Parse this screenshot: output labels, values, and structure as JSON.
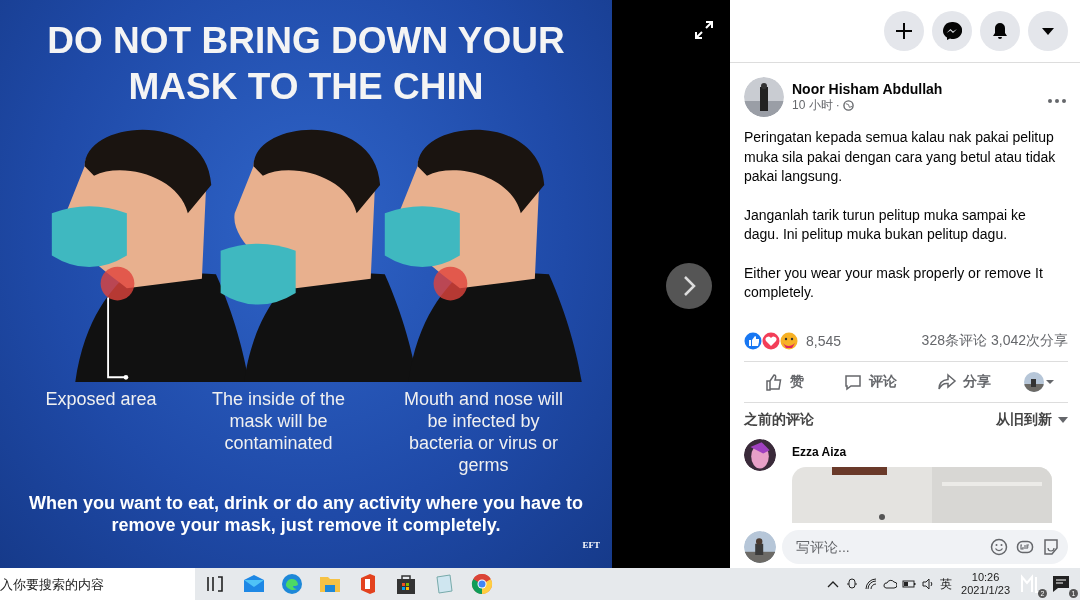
{
  "viewer": {
    "poster": {
      "headline": "DO NOT BRING DOWN YOUR MASK TO THE CHIN",
      "captions": [
        "Exposed area",
        "The inside of the mask will be contaminated",
        "Mouth and nose will be infected by bacteria or virus or germs"
      ],
      "footer": "When you want to eat, drink or do any activity where you have to remove your mask, just remove it completely.",
      "credit": "EFT"
    }
  },
  "post": {
    "author": "Noor Hisham Abdullah",
    "time": "10 小时",
    "separator": "·",
    "paragraphs": [
      "Peringatan kepada semua kalau nak pakai pelitup muka sila pakai dengan cara yang betul atau tidak pakai langsung.",
      "Janganlah tarik turun pelitup muka sampai ke dagu. Ini pelitup muka bukan pelitup dagu.",
      "Either you wear your mask properly or remove It completely."
    ],
    "reaction_count": "8,545",
    "comment_count": "328条评论",
    "share_count": "3,042次分享",
    "actions": [
      {
        "kind": "like",
        "label": "赞"
      },
      {
        "kind": "comment",
        "label": "评论"
      },
      {
        "kind": "share",
        "label": "分享"
      }
    ]
  },
  "comments": {
    "heading": "之前的评论",
    "sort": "从旧到新",
    "items": [
      {
        "author": "Ezza Aiza"
      }
    ]
  },
  "composer": {
    "placeholder": "写评论..."
  },
  "taskbar": {
    "search": {
      "placeholder": "入你要搜索的内容"
    },
    "language": "英",
    "time": "10:26",
    "date": "2021/1/23",
    "app_badge": "2",
    "notification_count": "1"
  }
}
